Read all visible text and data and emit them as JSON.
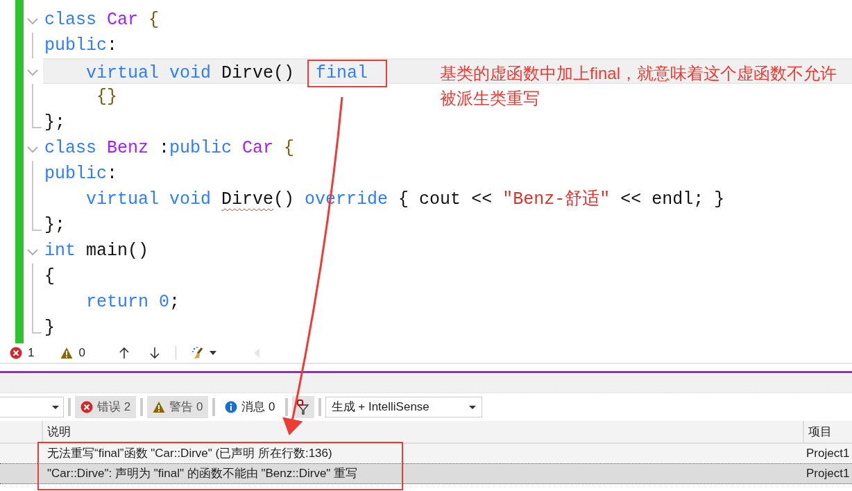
{
  "editor": {
    "lines": [
      {
        "kind": "collapse",
        "current": false,
        "tokens": [
          {
            "kind": "kw",
            "text": "class "
          },
          {
            "kind": "type",
            "text": "Car"
          },
          {
            "kind": "punct",
            "text": " {"
          }
        ]
      },
      {
        "kind": "guide",
        "current": false,
        "tokens": [
          {
            "kind": "kw",
            "text": "public"
          },
          {
            "kind": "plain",
            "text": ":"
          }
        ]
      },
      {
        "kind": "collapse",
        "current": true,
        "tokens": [
          {
            "kind": "kw",
            "text": "    virtual void "
          },
          {
            "kind": "plain",
            "text": "Dirve() "
          },
          {
            "kind": "kw",
            "text": "final",
            "boxed": true
          }
        ]
      },
      {
        "kind": "guide",
        "current": false,
        "tokens": [
          {
            "kind": "punct",
            "text": "     {}"
          }
        ]
      },
      {
        "kind": "end",
        "current": false,
        "tokens": [
          {
            "kind": "plain",
            "text": "};"
          }
        ]
      },
      {
        "kind": "collapse",
        "current": false,
        "tokens": [
          {
            "kind": "kw",
            "text": "class "
          },
          {
            "kind": "type",
            "text": "Benz"
          },
          {
            "kind": "plain",
            "text": " :"
          },
          {
            "kind": "kw",
            "text": "public "
          },
          {
            "kind": "type",
            "text": "Car"
          },
          {
            "kind": "punct",
            "text": " {"
          }
        ]
      },
      {
        "kind": "guide",
        "current": false,
        "tokens": [
          {
            "kind": "kw",
            "text": "public"
          },
          {
            "kind": "plain",
            "text": ":"
          }
        ]
      },
      {
        "kind": "guide",
        "current": false,
        "tokens": [
          {
            "kind": "kw",
            "text": "    virtual void "
          },
          {
            "kind": "plain",
            "text": "Dirve",
            "error": true
          },
          {
            "kind": "plain",
            "text": "() "
          },
          {
            "kind": "kw",
            "text": "override"
          },
          {
            "kind": "plain",
            "text": " { cout << "
          },
          {
            "kind": "str",
            "text": "\"Benz-舒适\""
          },
          {
            "kind": "plain",
            "text": " << endl; }"
          }
        ]
      },
      {
        "kind": "end",
        "current": false,
        "tokens": [
          {
            "kind": "plain",
            "text": "};"
          }
        ]
      },
      {
        "kind": "collapse",
        "current": false,
        "tokens": [
          {
            "kind": "kw",
            "text": "int "
          },
          {
            "kind": "plain",
            "text": "main()"
          }
        ]
      },
      {
        "kind": "guide",
        "current": false,
        "tokens": [
          {
            "kind": "plain",
            "text": "{"
          }
        ]
      },
      {
        "kind": "guide",
        "current": false,
        "tokens": [
          {
            "kind": "kw",
            "text": "    return "
          },
          {
            "kind": "num",
            "text": "0"
          },
          {
            "kind": "plain",
            "text": ";"
          }
        ]
      },
      {
        "kind": "end",
        "current": false,
        "tokens": [
          {
            "kind": "plain",
            "text": "}"
          }
        ]
      }
    ]
  },
  "annotation": {
    "text": "基类的虚函数中加上final，就意味着这个虚函数不允许被派生类重写"
  },
  "editor_status": {
    "errors": "1",
    "warnings": "0"
  },
  "error_list": {
    "filters": [
      {
        "kind": "error",
        "label": "错误 2",
        "selected": true
      },
      {
        "kind": "warning",
        "label": "警告 0",
        "selected": true
      },
      {
        "kind": "message",
        "label": "消息 0",
        "selected": false
      }
    ],
    "source": "生成 + IntelliSense",
    "columns": [
      "说明",
      "项目"
    ],
    "rows": [
      {
        "description": "无法重写“final”函数 \"Car::Dirve\" (已声明 所在行数:136)",
        "project": "Project1",
        "selected": false
      },
      {
        "description": "\"Car::Dirve\": 声明为 \"final\" 的函数不能由 \"Benz::Dirve\" 重写",
        "project": "Project1",
        "selected": true
      }
    ]
  }
}
